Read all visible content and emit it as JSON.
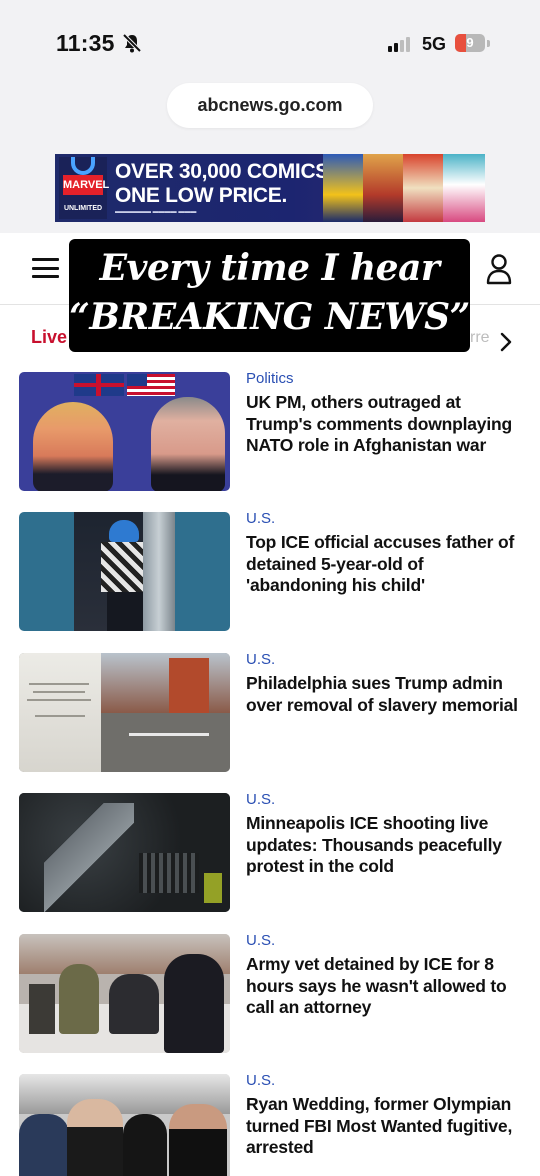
{
  "status_bar": {
    "time": "11:35",
    "network": "5G",
    "battery": "9",
    "battery_level": 0.09,
    "signal_bars": 2
  },
  "browser": {
    "url": "abcnews.go.com"
  },
  "ad": {
    "logo_text": "MARVEL",
    "logo_sub": "UNLIMITED",
    "line1": "OVER 30,000 COMICS.",
    "line2": "ONE LOW PRICE."
  },
  "overlay": {
    "line1": "Every time I hear",
    "line2": "“BREAKING NEWS”"
  },
  "nav": {
    "live_label": "Live",
    "tail_text": "rre"
  },
  "articles": [
    {
      "category": "Politics",
      "headline": "UK PM, others outraged at Trump's comments downplaying NATO role in Afghanistan war"
    },
    {
      "category": "U.S.",
      "headline": "Top ICE official accuses father of detained 5-year-old of 'abandoning his child'"
    },
    {
      "category": "U.S.",
      "headline": "Philadelphia sues Trump admin over removal of slavery memorial"
    },
    {
      "category": "U.S.",
      "headline": "Minneapolis ICE shooting live updates: Thousands peacefully protest in the cold"
    },
    {
      "category": "U.S.",
      "headline": "Army vet detained by ICE for 8 hours says he wasn't allowed to call an attorney"
    },
    {
      "category": "U.S.",
      "headline": "Ryan Wedding, former Olympian turned FBI Most Wanted fugitive, arrested"
    }
  ],
  "colors": {
    "live_red": "#c8102e",
    "category_blue": "#2a4fb3",
    "battery_red": "#e8503e"
  },
  "icons": [
    "bell-slash-icon",
    "signal-icon",
    "battery-icon",
    "hamburger-menu-icon",
    "user-icon",
    "chevron-right-icon"
  ]
}
